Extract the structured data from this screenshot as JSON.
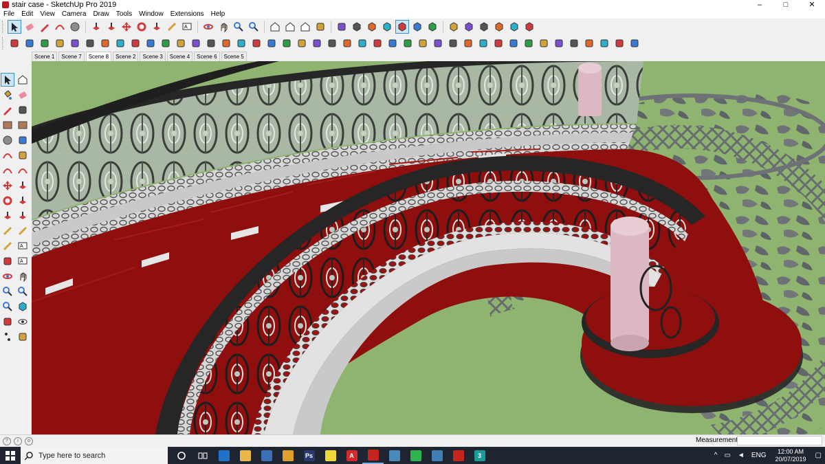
{
  "window": {
    "title": "stair case - SketchUp Pro 2019",
    "controls": {
      "minimize": "–",
      "maximize": "□",
      "close": "✕"
    }
  },
  "menu": [
    "File",
    "Edit",
    "View",
    "Camera",
    "Draw",
    "Tools",
    "Window",
    "Extensions",
    "Help"
  ],
  "scenes": [
    "Scene 1",
    "Scene 7",
    "Scene 8",
    "Scene 2",
    "Scene 3",
    "Scene 4",
    "Scene 6",
    "Scene 5"
  ],
  "active_scene": "Scene 8",
  "toolbar_top": [
    "select-icon",
    "eraser-icon",
    "pencil-icon",
    "arc-icon",
    "circle-icon",
    "push-pull-icon",
    "follow-me-icon",
    "move-icon",
    "rotate-icon",
    "scale-icon",
    "tape-measure-icon",
    "text-icon",
    "orbit-icon",
    "pan-icon",
    "zoom-icon",
    "zoom-extents-icon",
    "3d-warehouse-icon",
    "extension-warehouse-icon",
    "component-icon",
    "ruby-icon",
    "section-plane-icon",
    "xray-icon",
    "wireframe-icon",
    "hidden-line-icon",
    "shaded-icon",
    "shaded-textures-icon",
    "monochrome-icon",
    "iso-view-icon",
    "top-view-icon",
    "front-view-icon",
    "right-view-icon",
    "back-view-icon",
    "left-view-icon"
  ],
  "toolbar_second_count": 42,
  "left_tools": [
    "select-icon",
    "component-icon",
    "paint-bucket-icon",
    "eraser-icon",
    "line-icon",
    "freehand-icon",
    "rectangle-icon",
    "rotated-rectangle-icon",
    "circle-icon",
    "polygon-icon",
    "arc-icon",
    "pie-icon",
    "two-point-arc-icon",
    "three-point-arc-icon",
    "move-icon",
    "push-pull-icon",
    "rotate-icon",
    "follow-me-icon",
    "scale-icon",
    "offset-icon",
    "tape-measure-icon",
    "dimension-icon",
    "protractor-icon",
    "text-icon",
    "axes-icon",
    "3d-text-icon",
    "orbit-icon",
    "pan-icon",
    "zoom-icon",
    "zoom-window-icon",
    "zoom-extents-icon",
    "previous-view-icon",
    "position-camera-icon",
    "look-around-icon",
    "walk-icon",
    "section-plane-icon"
  ],
  "status": {
    "measurements_label": "Measurements",
    "measurements_value": ""
  },
  "taskbar": {
    "search_placeholder": "Type here to search",
    "apps": [
      "cortana-icon",
      "task-view-icon",
      "edge-icon",
      "file-explorer-icon",
      "store-icon",
      "chrome-icon",
      "photoshop-icon",
      "sticky-notes-icon",
      "autocad-icon",
      "sketchup-icon",
      "network-app-icon",
      "whatsapp-icon",
      "remote-app-icon",
      "sketchup-viewer-icon",
      "3ds-max-icon"
    ],
    "app_labels": {
      "photoshop": "Ps",
      "autocad": "A",
      "max": "3"
    },
    "tray": {
      "language": "ENG",
      "time": "12:00 AM",
      "date": "20/07/2019"
    }
  },
  "colors": {
    "carpet": "#8f0e0e",
    "handrail": "#262626",
    "baluster_panel_light": "#b8c5b3",
    "column": "#dcb9c2",
    "ground": "#8fb46f",
    "paving": "#6e7276",
    "taskbar": "#1f2530"
  }
}
